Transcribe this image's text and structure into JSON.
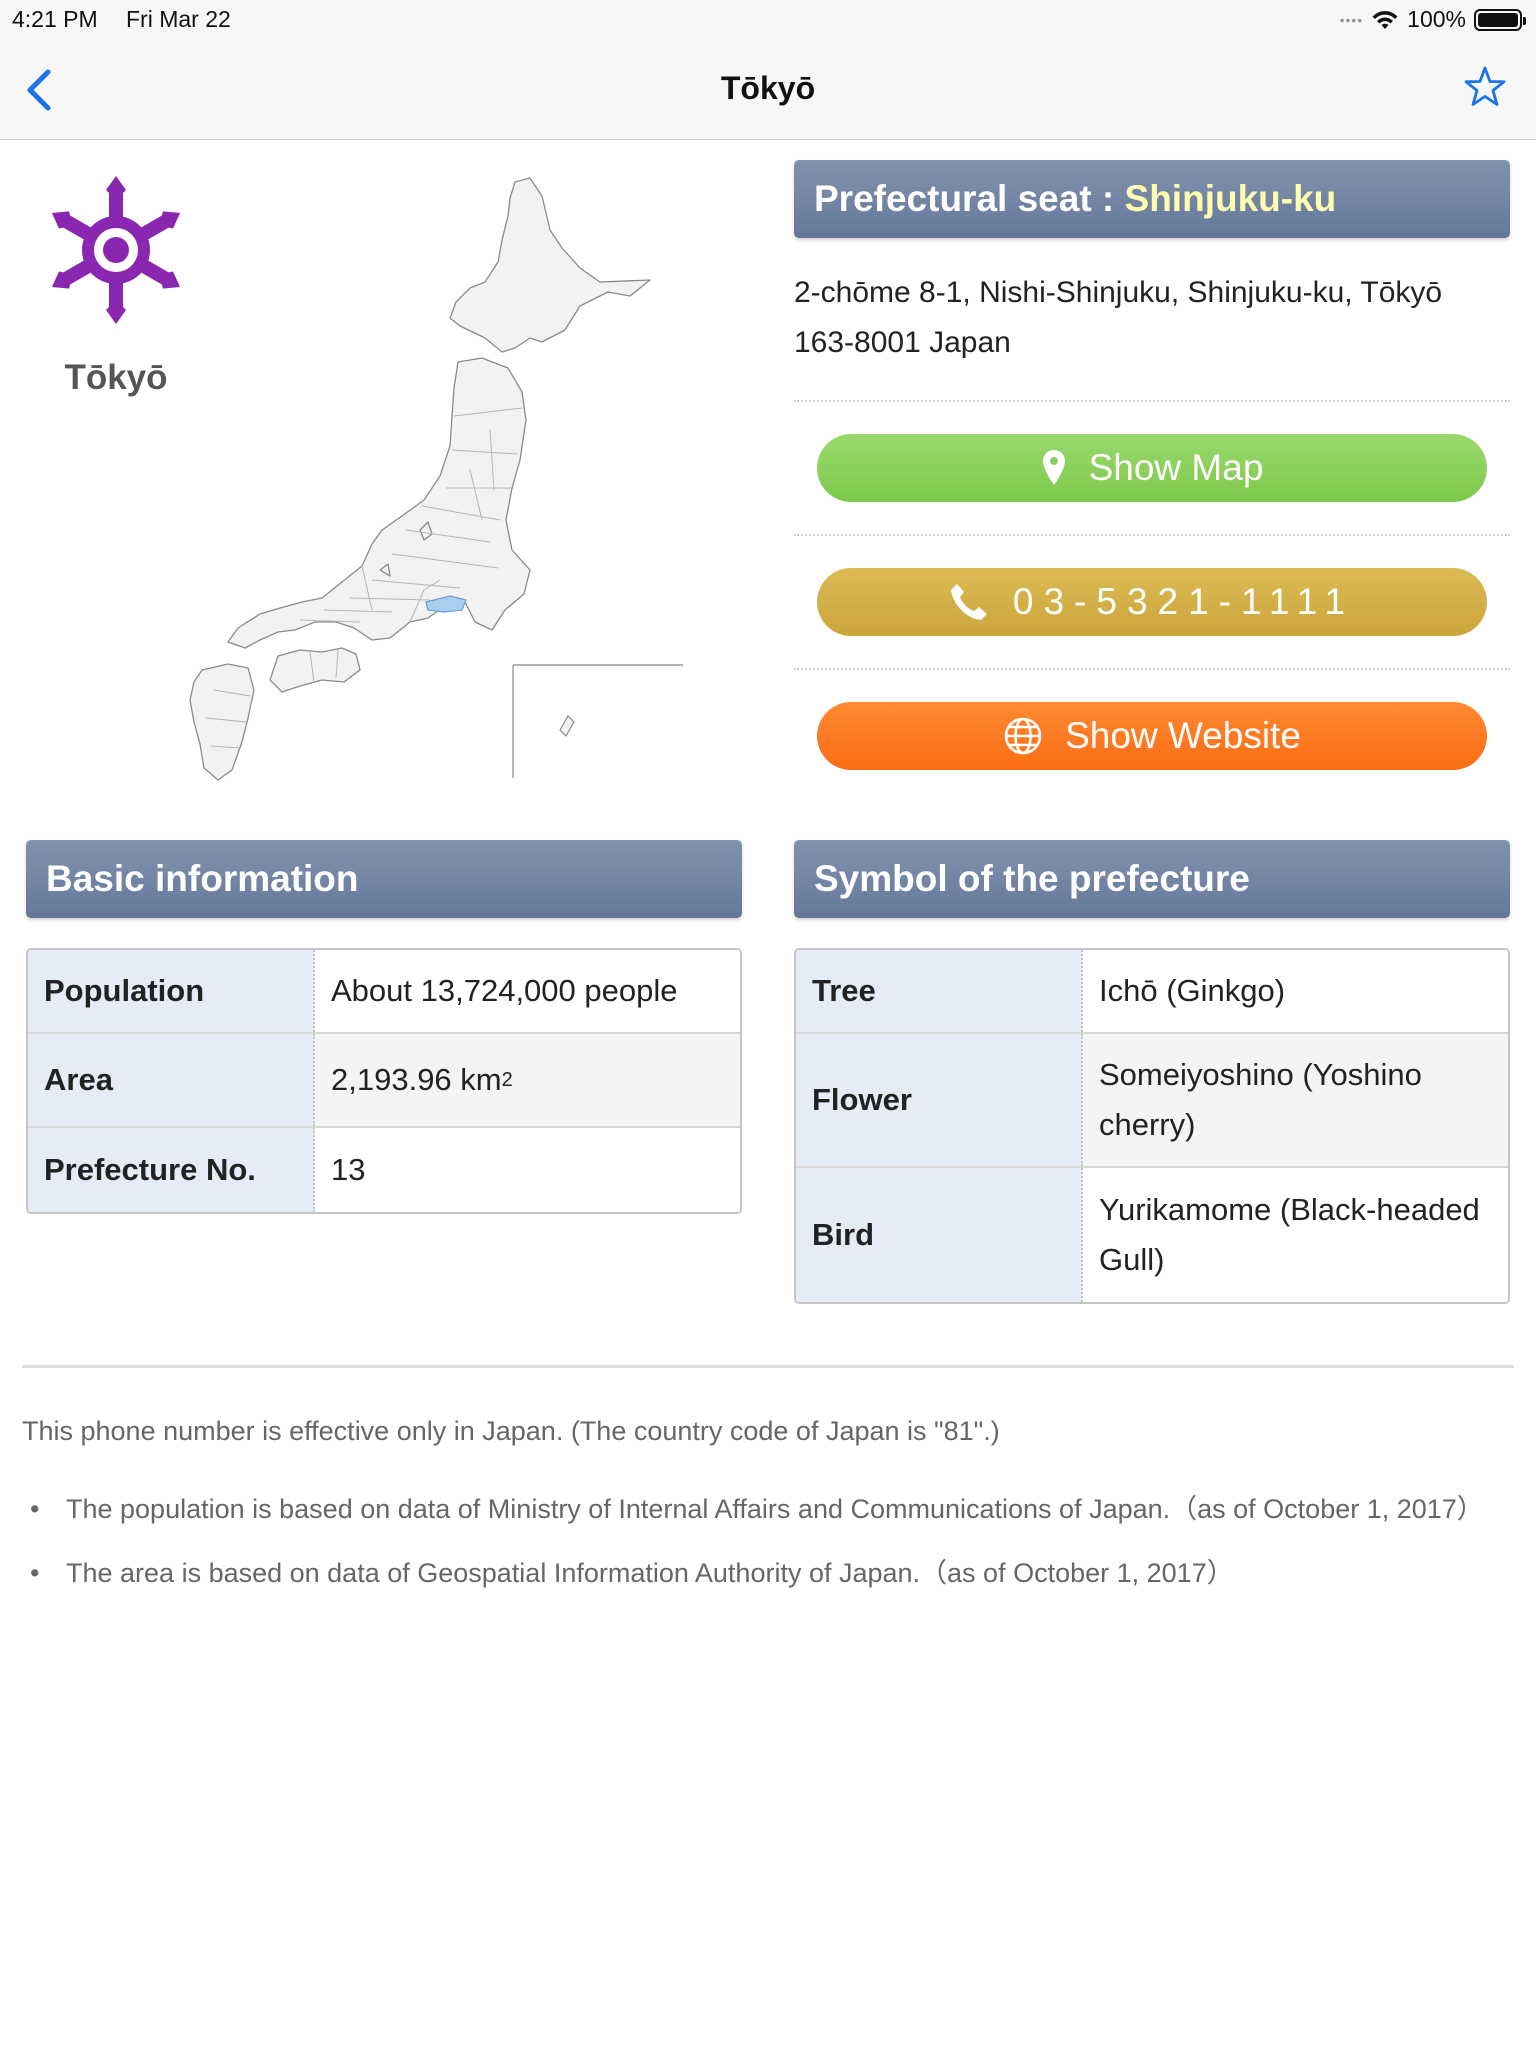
{
  "status_bar": {
    "time": "4:21 PM",
    "date": "Fri Mar 22",
    "battery": "100%"
  },
  "nav": {
    "title": "Tōkyō",
    "back_icon": "chevron-left-icon",
    "favorite_icon": "star-outline-icon"
  },
  "prefecture": {
    "name": "Tōkyō"
  },
  "seat": {
    "label": "Prefectural seat : ",
    "value": "Shinjuku-ku",
    "address": "2-chōme 8-1, Nishi-Shinjuku, Shinjuku-ku, Tōkyō 163-8001 Japan"
  },
  "actions": {
    "map_label": "Show Map",
    "phone_label": "03-5321-1111",
    "website_label": "Show Website"
  },
  "basic_info": {
    "header": "Basic information",
    "population_label": "Population",
    "population_value": "About 13,724,000 people",
    "area_label": "Area",
    "area_value": "2,193.96 km",
    "area_unit_exp": "2",
    "number_label": "Prefecture No.",
    "number_value": "13"
  },
  "symbols": {
    "header": "Symbol of the prefecture",
    "tree_label": "Tree",
    "tree_value": "Ichō (Ginkgo)",
    "flower_label": "Flower",
    "flower_value": "Someiyoshino (Yoshino cherry)",
    "bird_label": "Bird",
    "bird_value": "Yurikamome (Black-headed Gull)"
  },
  "notes": {
    "phone_note": "This phone number is effective only in Japan. (The country code of Japan is \"81\".)",
    "population_note": "The population is based on data of Ministry of Internal Affairs and Communications of Japan.（as of October 1, 2017）",
    "area_note": "The area is based on data of Geospatial Information Authority of Japan.（as of October 1, 2017）"
  },
  "colors": {
    "accent": "#1a73e8",
    "emblem": "#8a27b0",
    "header_bg": "#6f81a1",
    "map_button": "#8ad05c",
    "phone_button": "#d6b34a",
    "website_button": "#fb7a1f"
  }
}
